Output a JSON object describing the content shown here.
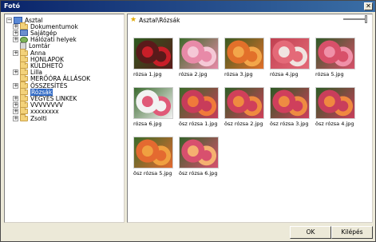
{
  "window": {
    "title": "Fotó",
    "close_glyph": "✕"
  },
  "tree": {
    "items": [
      {
        "label": "Asztal",
        "icon": "desktop-icon",
        "expander": "−",
        "level": 0
      },
      {
        "label": "Dokumentumok",
        "icon": "folder-icon",
        "expander": "+",
        "level": 1
      },
      {
        "label": "Sajátgép",
        "icon": "computer-icon",
        "expander": "+",
        "level": 1
      },
      {
        "label": "Hálózati helyek",
        "icon": "network-icon",
        "expander": "+",
        "level": 1
      },
      {
        "label": "Lomtár",
        "icon": "recycle-bin-icon",
        "expander": "",
        "level": 1
      },
      {
        "label": "Anna",
        "icon": "folder-icon",
        "expander": "+",
        "level": 1
      },
      {
        "label": "HONLAPOK",
        "icon": "folder-icon",
        "expander": "",
        "level": 1
      },
      {
        "label": "KÜLDHETŐ",
        "icon": "folder-icon",
        "expander": "",
        "level": 1
      },
      {
        "label": "Lilla",
        "icon": "folder-icon",
        "expander": "+",
        "level": 1
      },
      {
        "label": "MERŐÓRA ÁLLÁSOK",
        "icon": "folder-icon",
        "expander": "",
        "level": 1
      },
      {
        "label": "ÖSSZESÍTÉS",
        "icon": "folder-icon",
        "expander": "+",
        "level": 1
      },
      {
        "label": "Rózsák",
        "icon": "folder-icon",
        "expander": "",
        "level": 1,
        "selected": true
      },
      {
        "label": "VEGYES LINKEK",
        "icon": "folder-icon",
        "expander": "+",
        "level": 1
      },
      {
        "label": "VVVVVVVV",
        "icon": "folder-icon",
        "expander": "+",
        "level": 1
      },
      {
        "label": "xxxxxxxx",
        "icon": "folder-icon",
        "expander": "+",
        "level": 1
      },
      {
        "label": "Zsolti",
        "icon": "folder-icon",
        "expander": "+",
        "level": 1
      }
    ]
  },
  "path_bar": {
    "text": "Asztal\\Rózsák",
    "icon": "star-icon"
  },
  "thumbnails": [
    {
      "caption": "rózsa 1.jpg",
      "colors": [
        "#5a1a1a",
        "#c81e28",
        "#2d5a1e"
      ]
    },
    {
      "caption": "rózsa 2.jpg",
      "colors": [
        "#e88aa8",
        "#f5c8d6",
        "#3c6a2a"
      ]
    },
    {
      "caption": "rózsa 3.jpg",
      "colors": [
        "#e2702a",
        "#f3a64a",
        "#3a5a20"
      ]
    },
    {
      "caption": "rózsa 4.jpg",
      "colors": [
        "#e46a78",
        "#f0e4e0",
        "#c04050"
      ]
    },
    {
      "caption": "rózsa 5.jpg",
      "colors": [
        "#d8506a",
        "#f090a8",
        "#2e5a26"
      ]
    },
    {
      "caption": "rózsa 6.jpg",
      "colors": [
        "#f2f2f2",
        "#e05a78",
        "#3a6a2e"
      ]
    },
    {
      "caption": "ösz rózsa 1.jpg",
      "colors": [
        "#c83c5a",
        "#f07a3a",
        "#3a6a28"
      ]
    },
    {
      "caption": "ösz rózsa 2.jpg",
      "colors": [
        "#d0405a",
        "#ef8a40",
        "#2f5e26"
      ]
    },
    {
      "caption": "ösz rózsa 3.jpg",
      "colors": [
        "#cf3f5c",
        "#ee8b42",
        "#2c5a24"
      ]
    },
    {
      "caption": "ösz rózsa 4.jpg",
      "colors": [
        "#c93e5b",
        "#f08840",
        "#2d5c25"
      ]
    },
    {
      "caption": "ösz rózsa 5.jpg",
      "colors": [
        "#e46a30",
        "#f0a040",
        "#3a6a28"
      ]
    },
    {
      "caption": "ösz rózsa 6.jpg",
      "colors": [
        "#d8506e",
        "#f5b070",
        "#34622a"
      ]
    }
  ],
  "buttons": {
    "ok": "OK",
    "exit": "Kilépés"
  }
}
